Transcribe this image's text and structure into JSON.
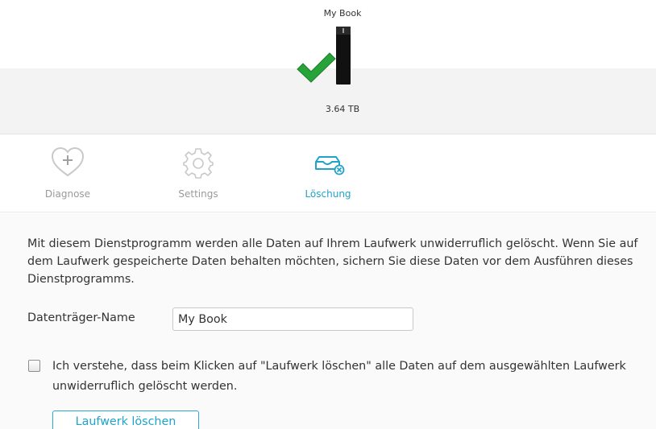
{
  "device": {
    "name": "My Book",
    "capacity": "3.64 TB",
    "status_icon": "checkmark-icon",
    "check_color": "#27a33a"
  },
  "tabs": [
    {
      "label": "Diagnose",
      "icon": "heart-plus-icon",
      "active": false
    },
    {
      "label": "Settings",
      "icon": "gear-icon",
      "active": false
    },
    {
      "label": "Löschung",
      "icon": "drive-erase-icon",
      "active": true
    }
  ],
  "erase": {
    "description": "Mit diesem Dienstprogramm werden alle Daten auf Ihrem Laufwerk unwiderruflich gelöscht. Wenn Sie auf dem Laufwerk gespeicherte Daten behalten möchten, sichern Sie diese Daten vor dem Ausführen dieses Dienstprogramms.",
    "volume_label": "Datenträger-Name",
    "volume_value": "My Book",
    "agree_text": "Ich verstehe, dass beim Klicken auf \"Laufwerk löschen\" alle Daten auf dem ausgewählten Laufwerk unwiderruflich gelöscht werden.",
    "agree_checked": false,
    "button_label": "Laufwerk löschen"
  },
  "colors": {
    "accent": "#1fa3c9",
    "inactive_tab": "#9a9a9a"
  }
}
